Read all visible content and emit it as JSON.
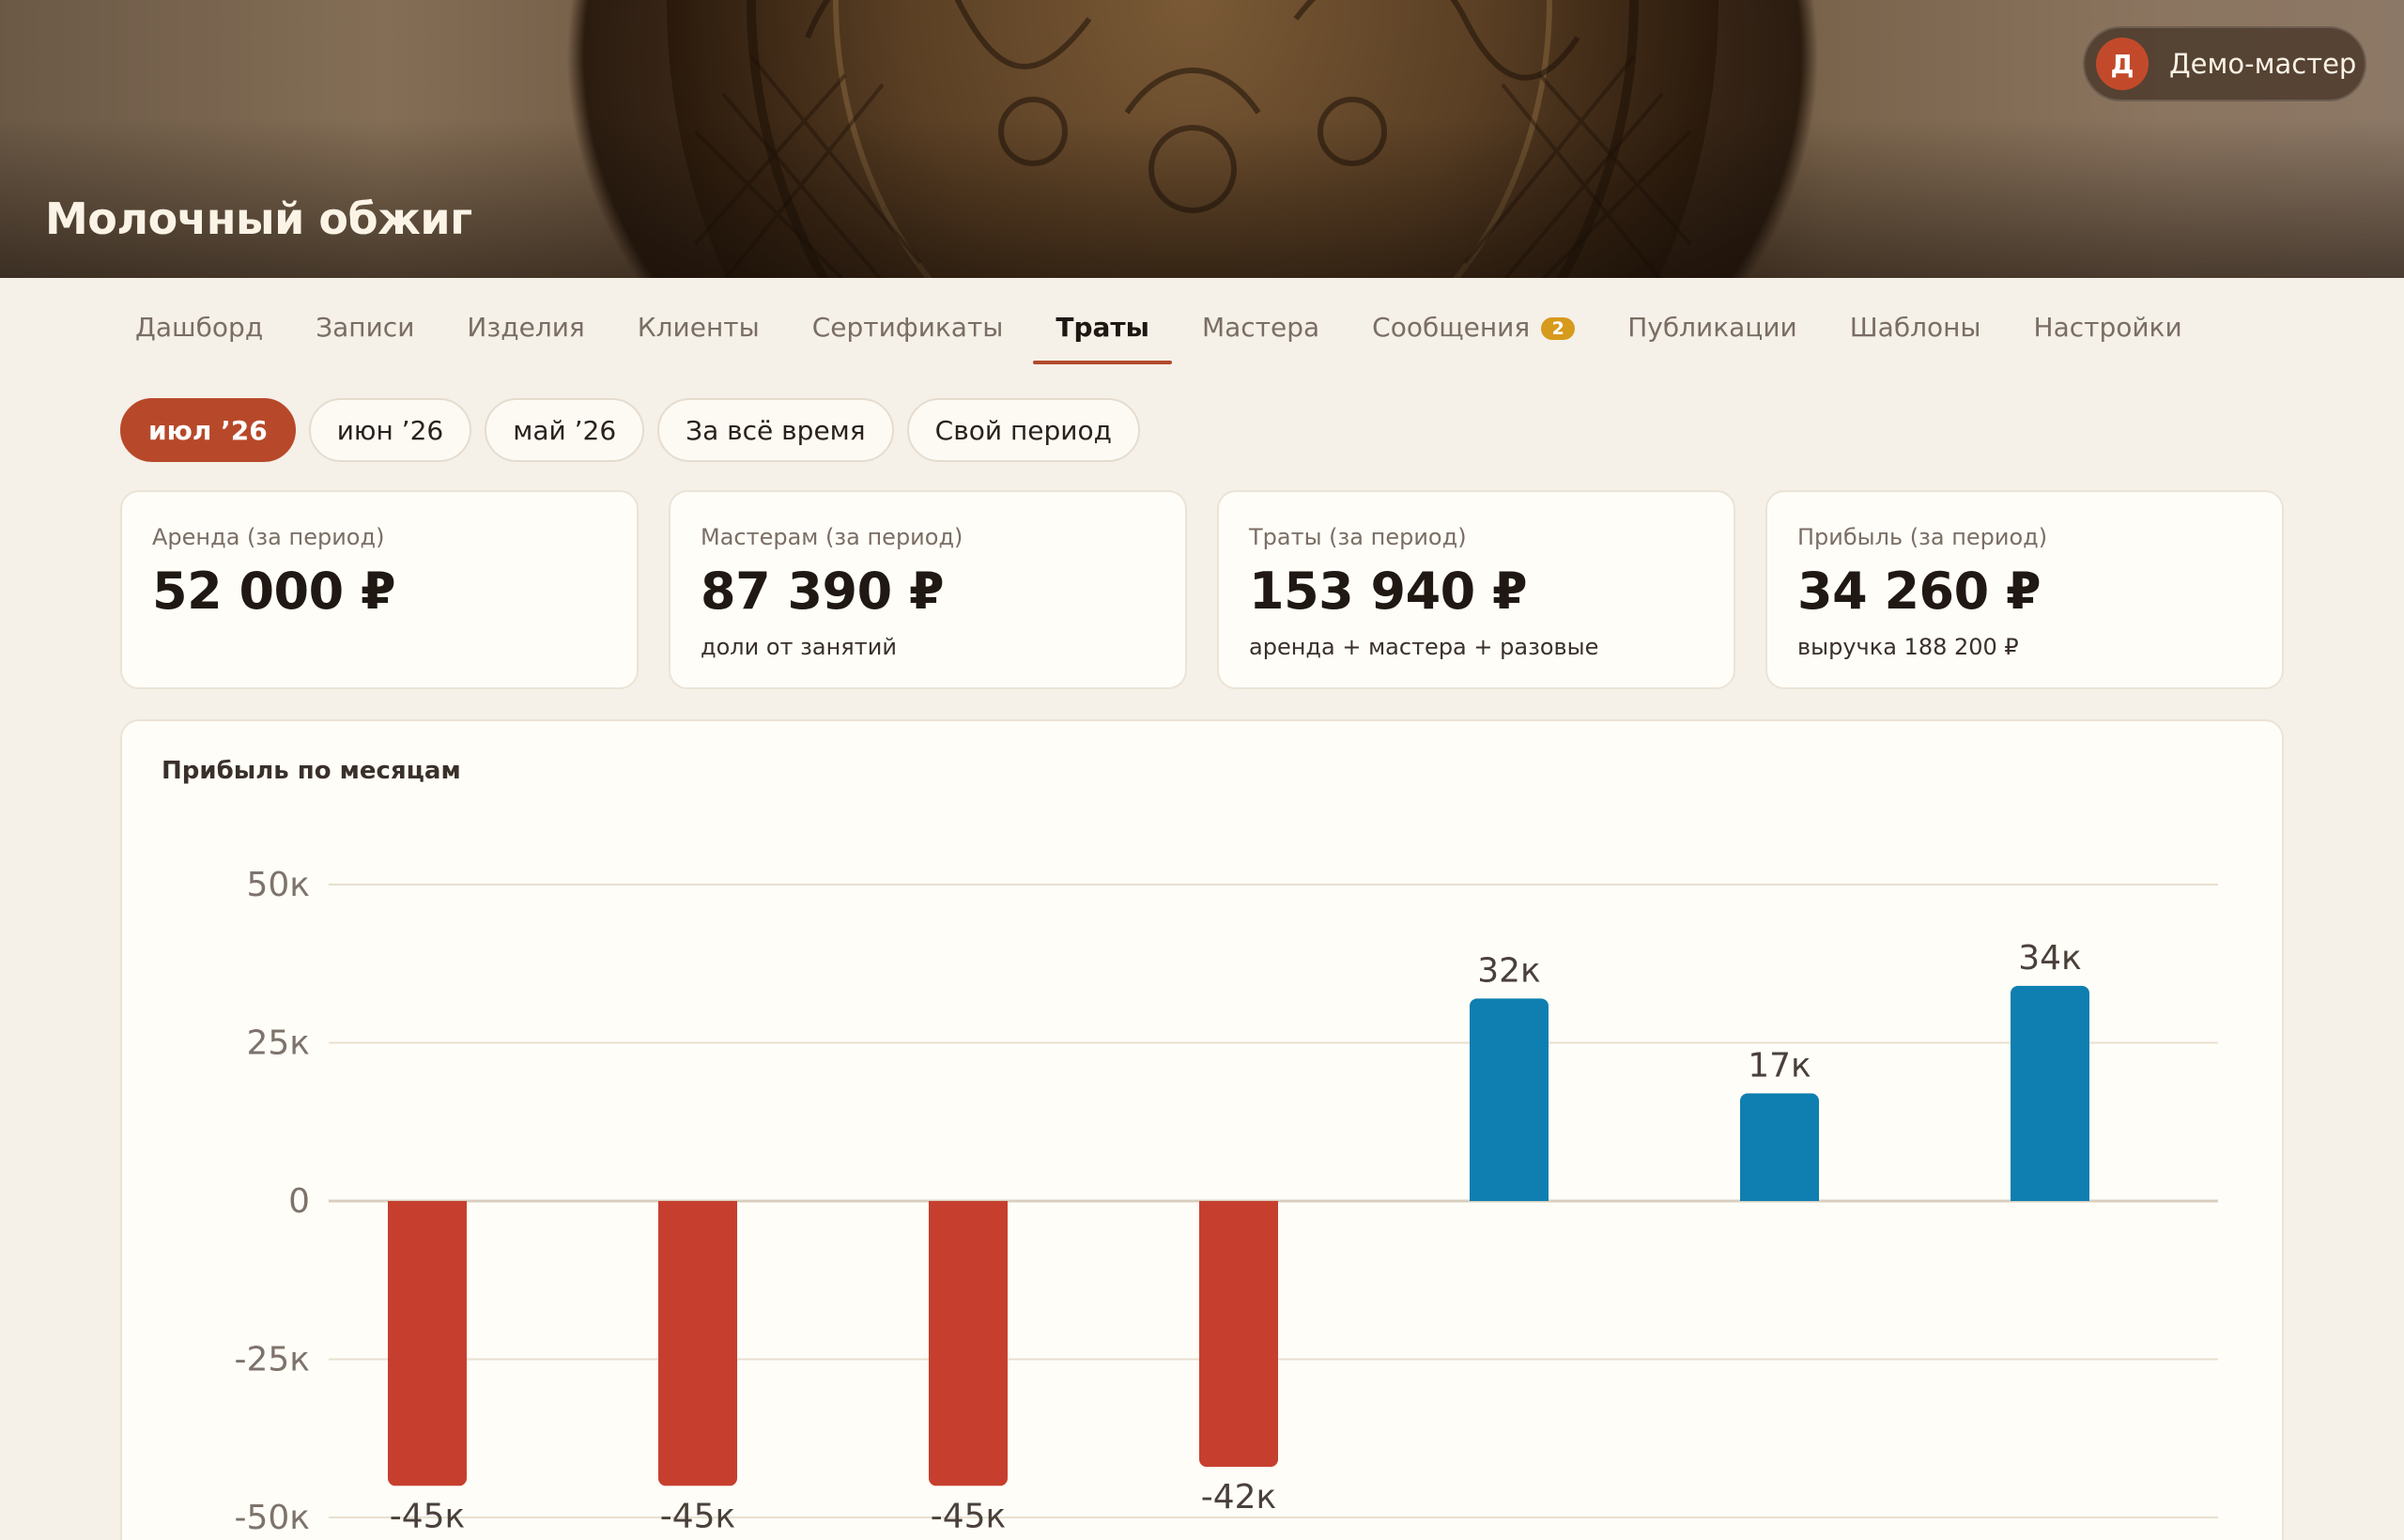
{
  "hero": {
    "title": "Молочный обжиг",
    "user": {
      "initial": "Д",
      "name": "Демо-мастер"
    }
  },
  "nav": {
    "items": [
      {
        "label": "Дашборд"
      },
      {
        "label": "Записи"
      },
      {
        "label": "Изделия"
      },
      {
        "label": "Клиенты"
      },
      {
        "label": "Сертификаты"
      },
      {
        "label": "Траты",
        "active": true
      },
      {
        "label": "Мастера"
      },
      {
        "label": "Сообщения",
        "badge": "2"
      },
      {
        "label": "Публикации"
      },
      {
        "label": "Шаблоны"
      },
      {
        "label": "Настройки"
      }
    ]
  },
  "periods": [
    {
      "label": "июл ’26",
      "active": true
    },
    {
      "label": "июн ’26"
    },
    {
      "label": "май ’26"
    },
    {
      "label": "За всё время"
    },
    {
      "label": "Свой период"
    }
  ],
  "stats": [
    {
      "label": "Аренда (за период)",
      "value": "52 000 ₽",
      "sub": ""
    },
    {
      "label": "Мастерам (за период)",
      "value": "87 390 ₽",
      "sub": "доли от занятий"
    },
    {
      "label": "Траты (за период)",
      "value": "153 940 ₽",
      "sub": "аренда + мастера + разовые"
    },
    {
      "label": "Прибыль (за период)",
      "value": "34 260 ₽",
      "sub": "выручка 188 200 ₽"
    }
  ],
  "chart_panel": {
    "title": "Прибыль по месяцам"
  },
  "chart_data": {
    "type": "bar",
    "title": "Прибыль по месяцам",
    "xlabel": "",
    "ylabel": "",
    "ylim": [
      -50000,
      50000
    ],
    "yticks": [
      50000,
      25000,
      0,
      -25000,
      -50000
    ],
    "ytick_labels": [
      "50к",
      "25к",
      "0",
      "-25к",
      "-50к"
    ],
    "grid": true,
    "values": [
      -45000,
      -45000,
      -45000,
      -42000,
      32000,
      17000,
      34000
    ],
    "data_labels": [
      "-45к",
      "-45к",
      "-45к",
      "-42к",
      "32к",
      "17к",
      "34к"
    ],
    "colors": {
      "positive": "#0e7fb0",
      "negative": "#c63f2e",
      "grid": "#e8dfcf",
      "zero": "#d9cfbf"
    }
  }
}
